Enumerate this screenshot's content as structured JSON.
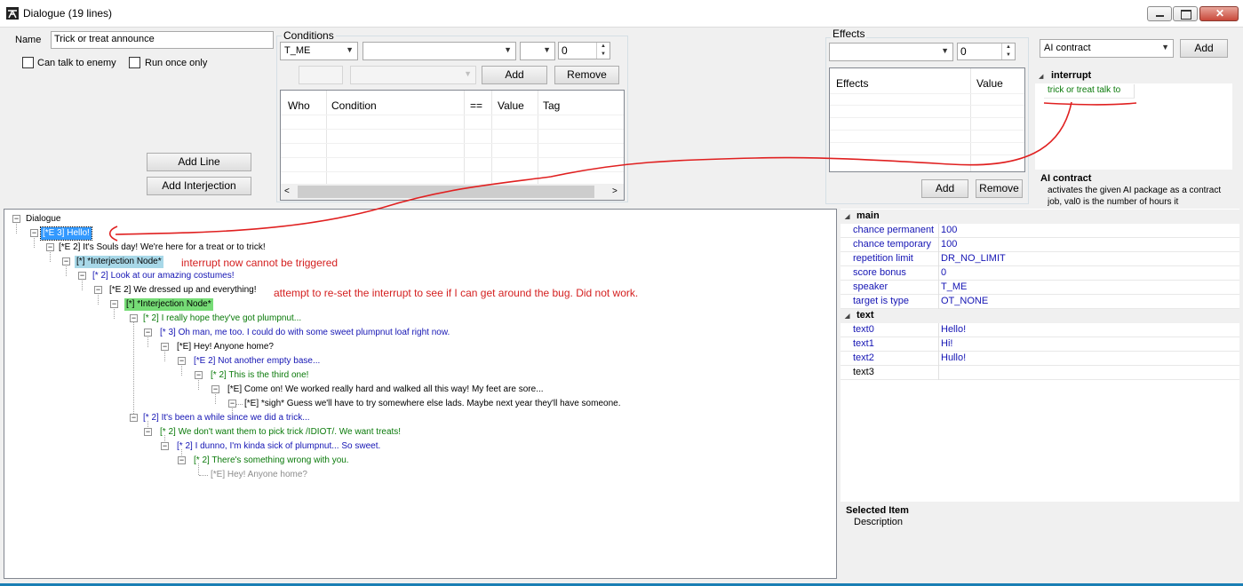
{
  "window": {
    "title": "Dialogue (19 lines)",
    "min_icon": "minimize-icon",
    "max_icon": "maximize-icon",
    "close_icon": "close-icon"
  },
  "form": {
    "name_label": "Name",
    "name_value": "Trick or treat announce",
    "can_talk_label": "Can talk to enemy",
    "run_once_label": "Run once only",
    "add_line": "Add Line",
    "add_interjection": "Add Interjection"
  },
  "conditions": {
    "group_label": "Conditions",
    "who_value": "T_ME",
    "condition_value": "",
    "op_value": "",
    "number_value": "0",
    "add": "Add",
    "remove": "Remove",
    "columns": [
      "Who",
      "Condition",
      "==",
      "Value",
      "Tag"
    ]
  },
  "effects": {
    "group_label": "Effects",
    "combo_value": "",
    "number_value": "0",
    "columns": [
      "Effects",
      "Value"
    ],
    "add": "Add",
    "remove": "Remove"
  },
  "ai_panel": {
    "combo_value": "AI contract",
    "add": "Add",
    "category": "interrupt",
    "items": [
      "trick or treat talk to"
    ],
    "desc_title": "AI contract",
    "desc_text": "activates the given AI package as a contract job, val0 is the number of hours it"
  },
  "tree": {
    "root": "Dialogue",
    "nodes": [
      {
        "text": "[*E 3] Hello!",
        "style": "sel-blue"
      },
      {
        "text": "[*E 2] It's Souls day! We're here for a treat or to trick!",
        "style": "c-black"
      },
      {
        "text": "[*] *Interjection Node*",
        "style": "sel-cyan"
      },
      {
        "text": "[* 2] Look at our amazing costumes!",
        "style": "c-blue"
      },
      {
        "text": "[*E 2] We dressed up and everything!",
        "style": "c-black"
      },
      {
        "text": "[*] *Interjection Node*",
        "style": "sel-green"
      },
      {
        "text": "[* 2] I really hope they've got plumpnut...",
        "style": "c-green"
      },
      {
        "text": "[* 3] Oh man, me too. I could do with some sweet plumpnut loaf right now.",
        "style": "c-blue"
      },
      {
        "text": "[*E] Hey! Anyone home?",
        "style": "c-black"
      },
      {
        "text": "[*E 2] Not another empty base...",
        "style": "c-blue"
      },
      {
        "text": "[* 2] This is the third one!",
        "style": "c-green"
      },
      {
        "text": "[*E] Come on! We worked really hard and walked all this way! My feet are sore...",
        "style": "c-black"
      },
      {
        "text": "[*E] *sigh* Guess we'll have to try somewhere else lads. Maybe next year they'll have someone.",
        "style": "c-black"
      },
      {
        "text": "[* 2] It's been a while since we did a trick...",
        "style": "c-blue"
      },
      {
        "text": "[* 2] We don't want them to pick trick /IDIOT/. We want treats!",
        "style": "c-green"
      },
      {
        "text": "[* 2] I dunno, I'm kinda sick of plumpnut... So sweet.",
        "style": "c-blue"
      },
      {
        "text": "[* 2] There's something wrong with you.",
        "style": "c-green"
      },
      {
        "text": "[*E] Hey! Anyone home?",
        "style": "c-gray"
      }
    ]
  },
  "annotations": {
    "note1": "interrupt now cannot be triggered",
    "note2": "attempt to re-set the interrupt to see if I can get around the bug. Did not work.",
    "color": "#d42020"
  },
  "properties": {
    "main_label": "main",
    "main_rows": [
      {
        "name": "chance permanent",
        "value": "100"
      },
      {
        "name": "chance temporary",
        "value": "100"
      },
      {
        "name": "repetition limit",
        "value": "DR_NO_LIMIT"
      },
      {
        "name": "score bonus",
        "value": "0"
      },
      {
        "name": "speaker",
        "value": "T_ME"
      },
      {
        "name": "target is type",
        "value": "OT_NONE"
      }
    ],
    "text_label": "text",
    "text_rows": [
      {
        "name": "text0",
        "value": "Hello!"
      },
      {
        "name": "text1",
        "value": "Hi!"
      },
      {
        "name": "text2",
        "value": "Hullo!"
      },
      {
        "name": "text3",
        "value": ""
      }
    ]
  },
  "selected": {
    "title": "Selected Item",
    "desc": "Description"
  }
}
